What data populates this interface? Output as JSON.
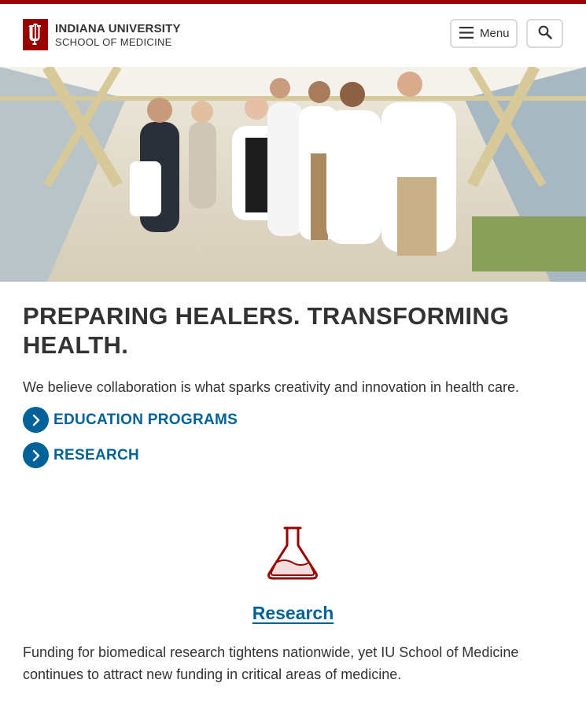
{
  "header": {
    "logo_line1": "INDIANA UNIVERSITY",
    "logo_line2": "SCHOOL OF MEDICINE",
    "menu_label": "Menu",
    "menu_icon": "hamburger-icon",
    "search_icon": "search-icon"
  },
  "colors": {
    "brand_crimson": "#990000",
    "link_blue": "#006298",
    "text": "#333333"
  },
  "hero": {
    "image": "hero-photo"
  },
  "main": {
    "headline": "PREPARING HEALERS. TRANSFORMING HEALTH.",
    "intro": "We believe collaboration is what sparks creativity and innovation in health care.",
    "ctas": [
      {
        "label": "EDUCATION PROGRAMS",
        "icon": "chevron-right-icon"
      },
      {
        "label": "RESEARCH",
        "icon": "chevron-right-icon"
      }
    ]
  },
  "research_card": {
    "icon": "flask-icon",
    "title": "Research",
    "body": "Funding for biomedical research tightens nationwide, yet IU School of Medicine continues to attract new funding in critical areas of medicine."
  }
}
